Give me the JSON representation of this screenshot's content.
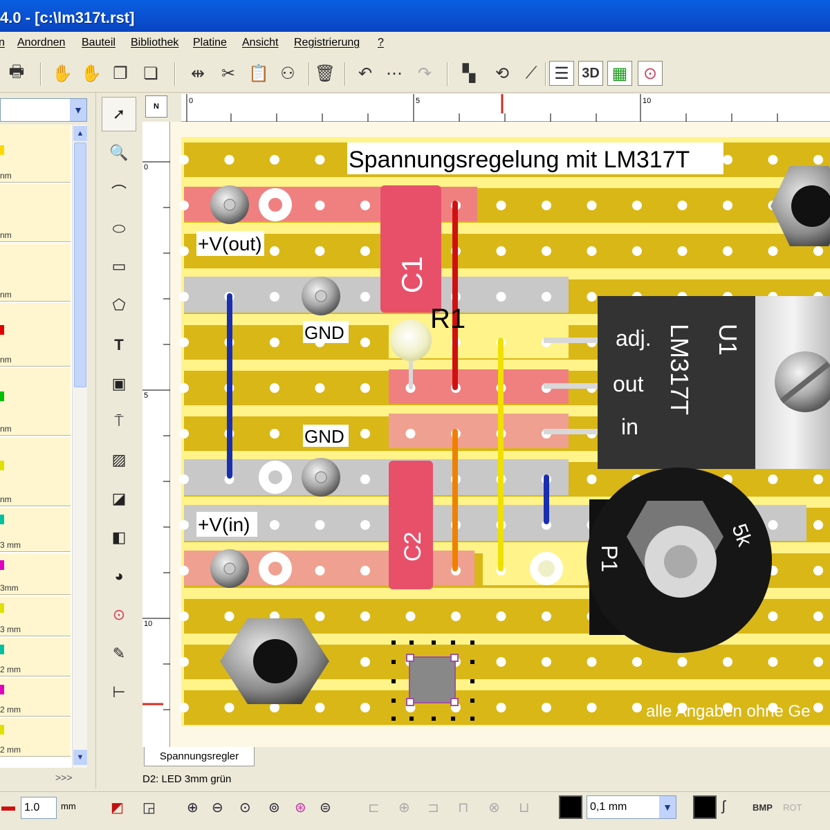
{
  "window": {
    "title": "4.0 - [c:\\lm317t.rst]"
  },
  "menu": [
    "n",
    "Anordnen",
    "Bauteil",
    "Bibliothek",
    "Platine",
    "Ansicht",
    "Registrierung",
    "?"
  ],
  "toolbar": {
    "label_3d": "3D"
  },
  "library": {
    "items": [
      {
        "label": "nm",
        "color": "#ffd700"
      },
      {
        "label": "nm",
        "color": "#ffd700"
      },
      {
        "label": "nm",
        "color": "#ffd700"
      },
      {
        "label": "nm",
        "color": "#e00000"
      },
      {
        "label": "nm",
        "color": "#00c000"
      },
      {
        "label": "nm",
        "color": "#e0e000"
      },
      {
        "label": "3 mm",
        "color": "#00c0a0"
      },
      {
        "label": "3mm",
        "color": "#e000c0"
      },
      {
        "label": "3 mm",
        "color": "#e0e000"
      },
      {
        "label": "2 mm",
        "color": "#00c0a0"
      },
      {
        "label": "2 mm",
        "color": "#e000c0"
      },
      {
        "label": "2 mm",
        "color": "#e0e000"
      }
    ],
    "more": ">>>"
  },
  "ruler": {
    "h": [
      "0",
      "5",
      "10"
    ],
    "v": [
      "0",
      "5",
      "10"
    ],
    "corner": "N"
  },
  "board": {
    "title": "Spannungsregelung mit LM317T",
    "labels": {
      "vout": "+V(out)",
      "gnd1": "GND",
      "gnd2": "GND",
      "vin": "+V(in)",
      "c1": "C1",
      "c2": "C2",
      "r1": "R1",
      "u1": "U1",
      "lm": "LM317T",
      "adj": "adj.",
      "out": "out",
      "in": "in",
      "p1": "P1",
      "p1val": "5k",
      "footer": "alle Angaben ohne Ge"
    }
  },
  "tabs": [
    "Spannungsregler"
  ],
  "status": {
    "text": "D2: LED 3mm grün"
  },
  "bottom": {
    "width_value": "1.0",
    "width_unit": "mm",
    "grid_value": "0,1 mm",
    "bmp": "BMP",
    "rot": "ROT"
  },
  "colors": {
    "strip": "#d9b716",
    "board_bg": "#fff38a",
    "track_vout": "#f08080",
    "track_gnd": "#c8c8c8",
    "track_vin": "#f0a090",
    "wire_blue": "#1a2fb0",
    "wire_red": "#d01010",
    "wire_orange": "#f08000",
    "wire_yellow": "#f0e000"
  }
}
